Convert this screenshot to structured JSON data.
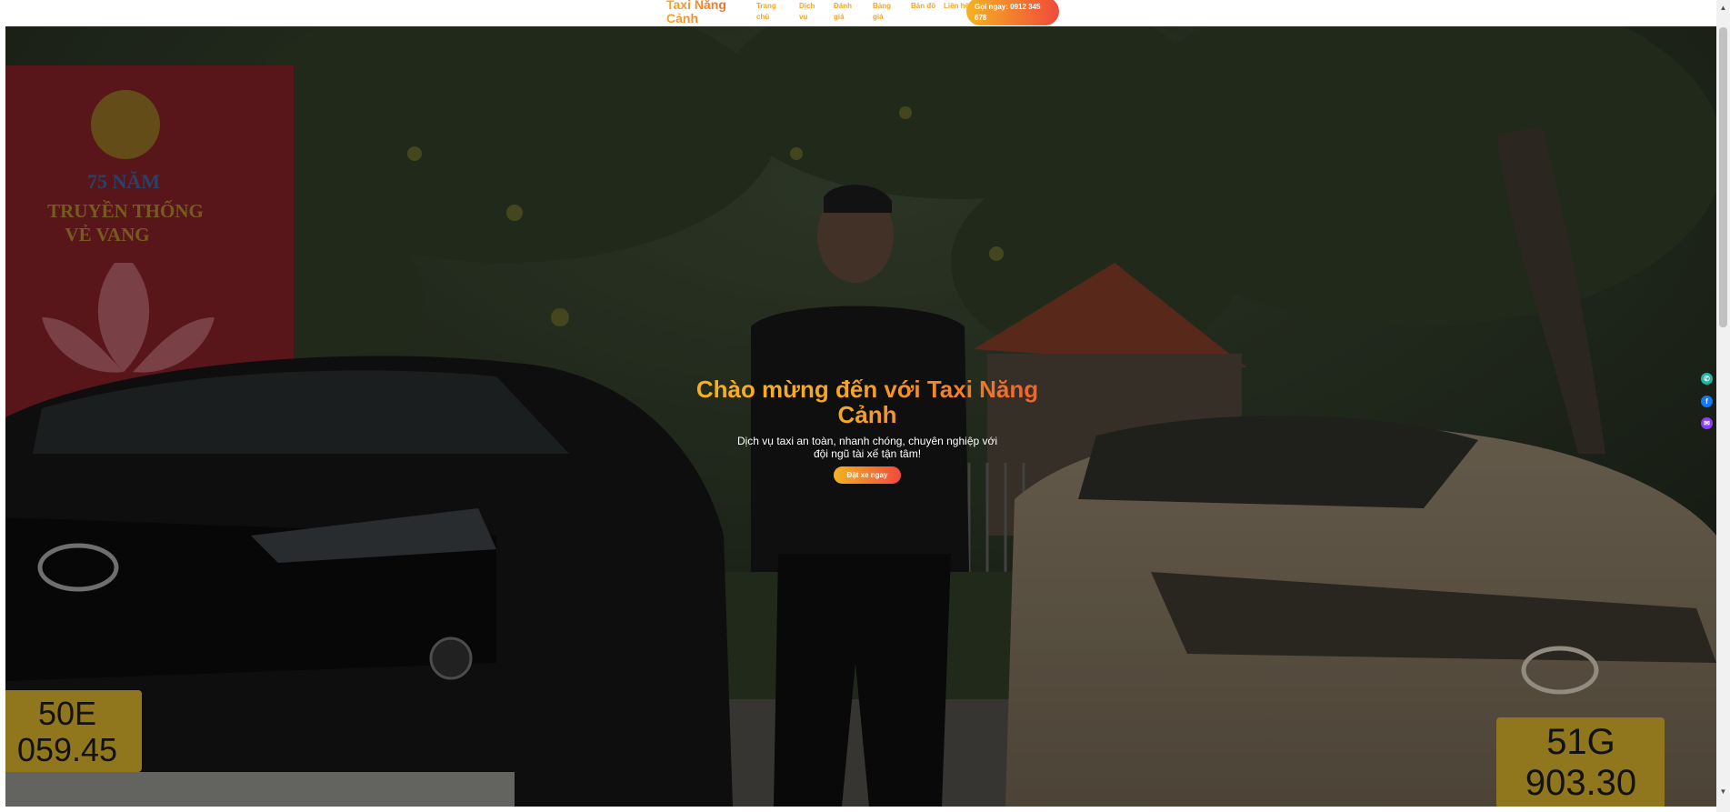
{
  "header": {
    "brand": "Taxi Năng Cảnh",
    "nav": [
      "Trang chủ",
      "Dịch vụ",
      "Đánh giá",
      "Bảng giá",
      "Bản đồ",
      "Liên hệ"
    ],
    "call_label": "Gọi ngay: 0912 345 678"
  },
  "hero": {
    "title": "Chào mừng đến với Taxi Năng Cảnh",
    "subtitle": "Dịch vụ taxi an toàn, nhanh chóng, chuyên nghiệp với đội ngũ tài xế tận tâm!",
    "button": "Đặt xe ngay",
    "photo": {
      "banner_line1": "75 NĂM",
      "banner_line2": "TRUYỀN THỐNG",
      "banner_line3": "VẺ VANG",
      "plate_left_1": "50E",
      "plate_left_2": "059.45",
      "plate_right_1": "51G",
      "plate_right_2": "903.30"
    }
  },
  "floating": [
    {
      "icon": "phone-icon",
      "glyph": "✆",
      "color": "#1fb5a4"
    },
    {
      "icon": "facebook-icon",
      "glyph": "f",
      "color": "#1877f2"
    },
    {
      "icon": "messenger-icon",
      "glyph": "✉",
      "color": "#8b3dff"
    }
  ]
}
